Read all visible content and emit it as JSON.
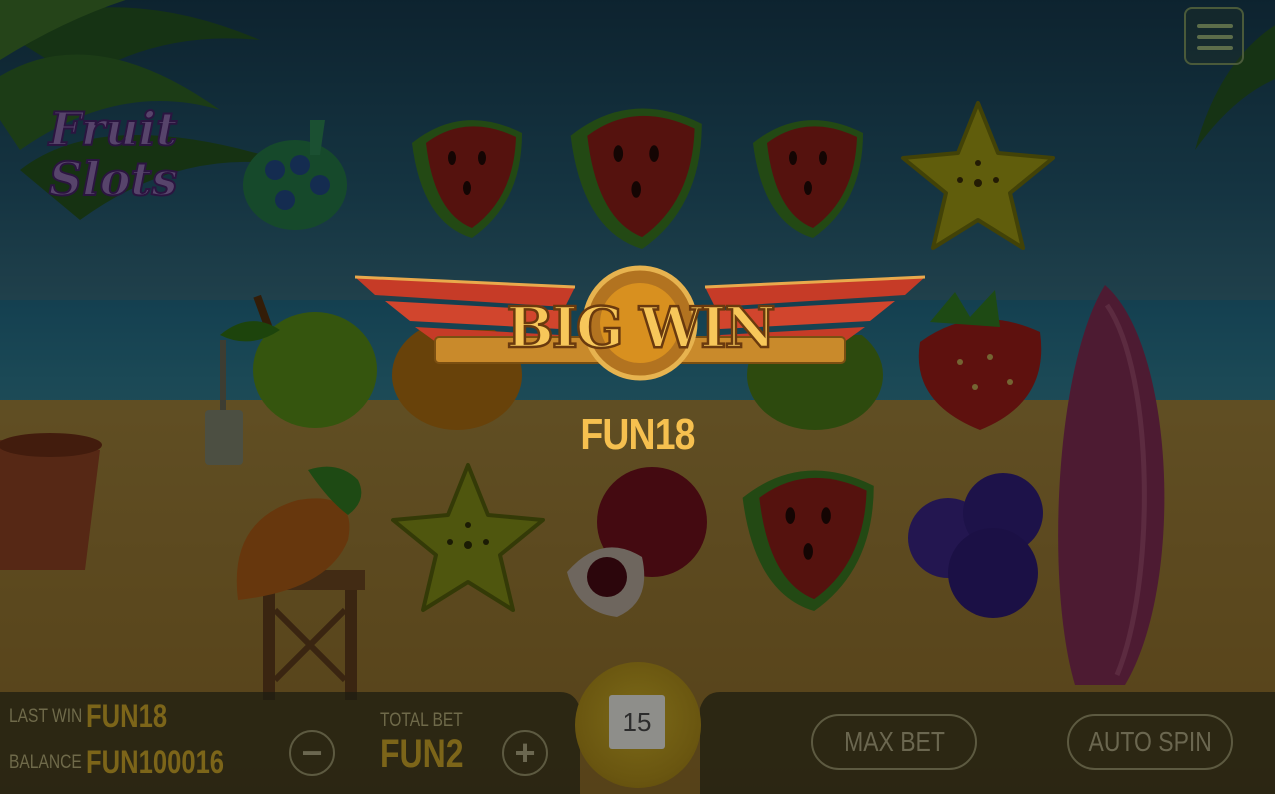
{
  "game": {
    "logo_line1": "Fruit",
    "logo_line2": "Slots"
  },
  "reels": {
    "rows": [
      [
        "paint-palette",
        "watermelon",
        "watermelon",
        "watermelon",
        "star-fruit"
      ],
      [
        "apple",
        "orange",
        "orange",
        "lime",
        "strawberry"
      ],
      [
        "carrot",
        "star-fruit",
        "pomegranate",
        "watermelon",
        "blueberries"
      ]
    ]
  },
  "win_overlay": {
    "title": "BIG WIN",
    "amount": "FUN18"
  },
  "bottom_bar": {
    "last_win_label": "LAST WIN",
    "last_win_value": "FUN18",
    "balance_label": "BALANCE",
    "balance_value": "FUN100016",
    "total_bet_label": "TOTAL BET",
    "total_bet_value": "FUN2",
    "decrease_symbol": "−",
    "increase_symbol": "+",
    "spin_count": "15",
    "max_bet_label": "MAX BET",
    "auto_spin_label": "AUTO SPIN"
  },
  "icons": {
    "menu": "hamburger-menu-icon"
  },
  "colors": {
    "win_gold": "#f6c04f",
    "bar_text": "#7c6519",
    "dim_overlay": "rgba(0,0,0,0.52)"
  }
}
